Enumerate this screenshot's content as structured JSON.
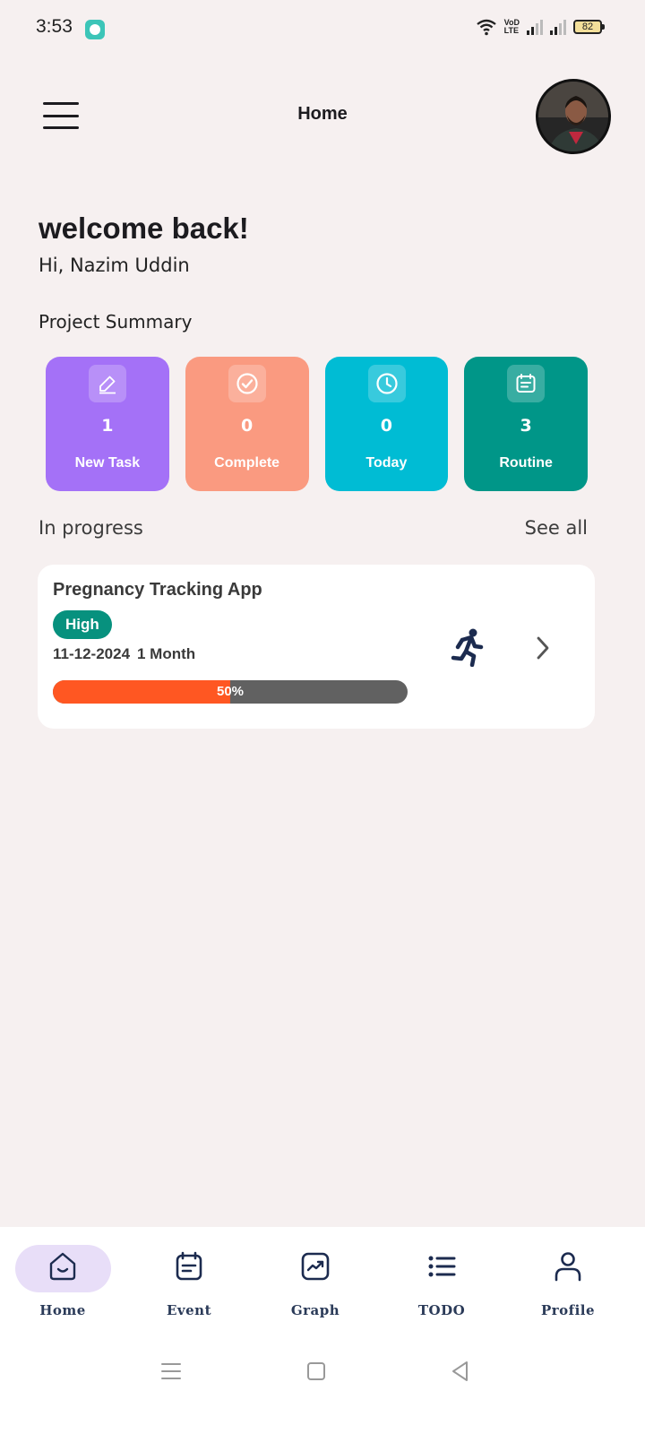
{
  "status_bar": {
    "time": "3:53",
    "volte_label_line1": "VoD",
    "volte_label_line2": "LTE",
    "battery": "82"
  },
  "header": {
    "title": "Home"
  },
  "welcome": {
    "heading": "welcome back!",
    "greeting": "Hi, Nazim Uddin"
  },
  "summary": {
    "title": "Project Summary",
    "cards": [
      {
        "count": "1",
        "label": "New Task",
        "icon": "pencil-icon",
        "color": "#a471f7"
      },
      {
        "count": "0",
        "label": "Complete",
        "icon": "check-circle-icon",
        "color": "#fa9a80"
      },
      {
        "count": "0",
        "label": "Today",
        "icon": "clock-icon",
        "color": "#00bcd4"
      },
      {
        "count": "3",
        "label": "Routine",
        "icon": "calendar-icon",
        "color": "#009688"
      }
    ]
  },
  "in_progress": {
    "title": "In progress",
    "see_all": "See all",
    "project": {
      "name": "Pregnancy Tracking App",
      "priority": "High",
      "date": "11-12-2024",
      "duration": "1 Month",
      "progress_label": "50%",
      "progress": 0.5,
      "icon": "running-person-icon"
    }
  },
  "bottom_nav": {
    "items": [
      {
        "label": "Home",
        "icon": "home-icon",
        "active": true
      },
      {
        "label": "Event",
        "icon": "event-icon",
        "active": false
      },
      {
        "label": "Graph",
        "icon": "graph-icon",
        "active": false
      },
      {
        "label": "TODO",
        "icon": "list-icon",
        "active": false
      },
      {
        "label": "Profile",
        "icon": "profile-icon",
        "active": false
      }
    ]
  },
  "colors": {
    "background": "#f6f0f0",
    "priority_high": "#07917e",
    "progress_fill": "#ff5722",
    "progress_track": "#616161",
    "nav_active_pill": "#e8def8",
    "nav_icon": "#1c2b4f"
  }
}
